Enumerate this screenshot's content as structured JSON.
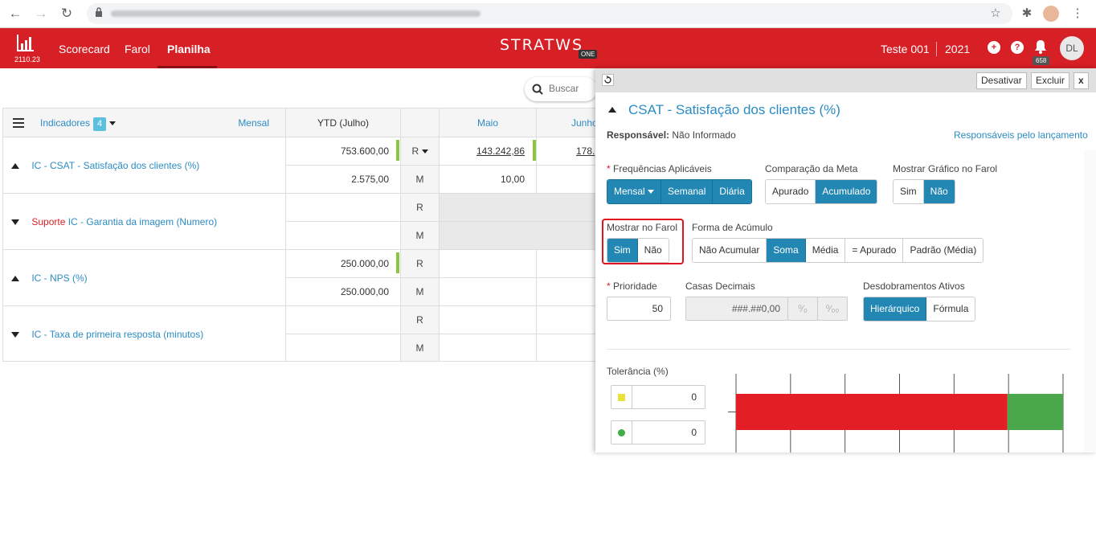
{
  "browser": {
    "back": "←",
    "forward": "→",
    "reload": "↻",
    "star": "☆",
    "puzzle": "✱",
    "menu": "⋮"
  },
  "header": {
    "version": "2110.23",
    "nav": [
      "Scorecard",
      "Farol",
      "Planilha"
    ],
    "logo": "STRATWS",
    "logo_badge": "ONE",
    "project": "Teste 001",
    "year": "2021",
    "notifications": "658",
    "avatar": "DL",
    "brand_color": "#d71f26"
  },
  "search": {
    "placeholder": "Buscar"
  },
  "table": {
    "indicators_label": "Indicadores",
    "indicators_count": "4",
    "period": "Mensal",
    "ytd_header": "YTD (Julho)",
    "month_headers": [
      "Maio",
      "Junho"
    ],
    "rows": [
      {
        "name_prefix": "",
        "name": "IC - CSAT - Satisfação dos clientes (%)",
        "expanded": true,
        "r_ytd": "753.600,00",
        "m_ytd": "2.575,00",
        "r_may": "143.242,86",
        "r_jun": "178.",
        "m_may": "10,00",
        "r_label": "R",
        "m_label": "M"
      },
      {
        "name_prefix": "Suporte",
        "name": "IC - Garantia da imagem (Numero)",
        "expanded": false,
        "r_ytd": "",
        "m_ytd": "",
        "r_label": "R",
        "m_label": "M"
      },
      {
        "name_prefix": "",
        "name": "IC - NPS (%)",
        "expanded": true,
        "r_ytd": "250.000,00",
        "m_ytd": "250.000,00",
        "r_label": "R",
        "m_label": "M"
      },
      {
        "name_prefix": "",
        "name": "IC - Taxa de primeira resposta (minutos)",
        "expanded": false,
        "r_ytd": "",
        "m_ytd": "",
        "r_label": "R",
        "m_label": "M"
      }
    ]
  },
  "panel": {
    "deactivate": "Desativar",
    "delete": "Excluir",
    "close": "x",
    "title": "CSAT - Satisfação dos clientes (%)",
    "responsible_label": "Responsável:",
    "responsible_value": "Não Informado",
    "responsibles_link": "Responsáveis pelo lançamento",
    "freq_label": "Frequências Aplicáveis",
    "freq_options": [
      "Mensal",
      "Semanal",
      "Diária"
    ],
    "meta_label": "Comparação da Meta",
    "meta_options": [
      "Apurado",
      "Acumulado"
    ],
    "chart_label": "Mostrar Gráfico no Farol",
    "chart_options": [
      "Sim",
      "Não"
    ],
    "show_label": "Mostrar no Farol",
    "show_options": [
      "Sim",
      "Não"
    ],
    "accum_label": "Forma de Acúmulo",
    "accum_options": [
      "Não Acumular",
      "Soma",
      "Média",
      "= Apurado",
      "Padrão (Média)"
    ],
    "priority_label": "Prioridade",
    "priority_value": "50",
    "decimals_label": "Casas Decimais",
    "decimals_value": "###.##0,00",
    "breakdown_label": "Desdobramentos Ativos",
    "breakdown_options": [
      "Hierárquico",
      "Fórmula"
    ],
    "tolerance_label": "Tolerância (%)",
    "tolerance_values": [
      "0",
      "0"
    ],
    "tolerance_colors": [
      "#e8e23a",
      "#3fae49"
    ],
    "tolerance_bar": [
      {
        "color": "#e31e25",
        "fraction": 0.83
      },
      {
        "color": "#4aa84a",
        "fraction": 0.17
      }
    ]
  }
}
